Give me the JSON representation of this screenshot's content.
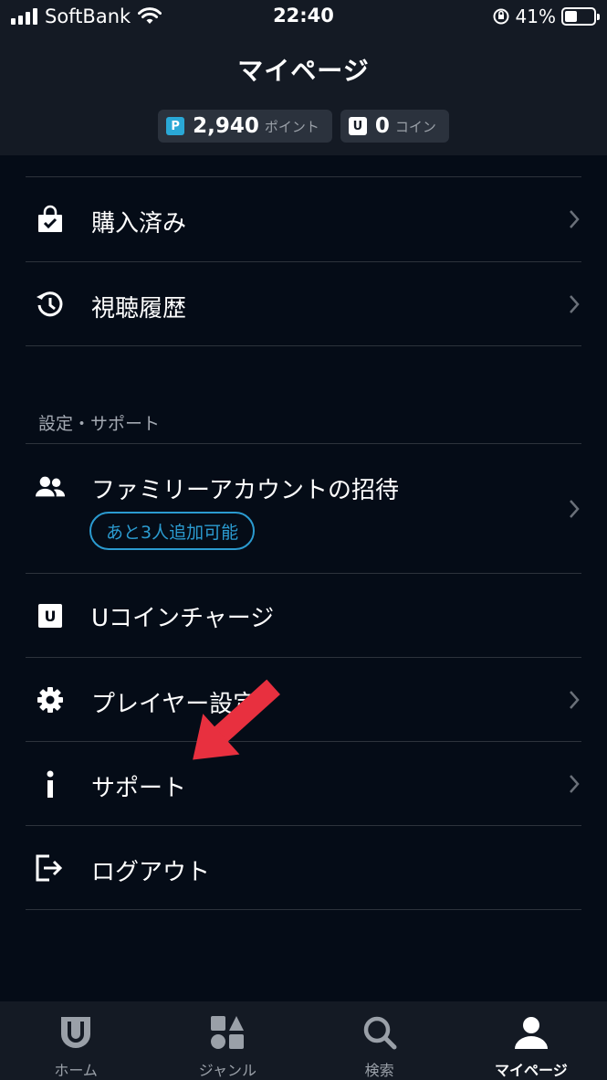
{
  "status_bar": {
    "carrier": "SoftBank",
    "time": "22:40",
    "battery": "41%"
  },
  "header": {
    "title": "マイページ",
    "points": {
      "badge": "P",
      "value": "2,940",
      "unit": "ポイント"
    },
    "coins": {
      "badge": "U",
      "value": "0",
      "unit": "コイン"
    }
  },
  "menu": {
    "purchased": "購入済み",
    "history": "視聴履歴",
    "section_settings": "設定・サポート",
    "family": "ファミリーアカウントの招待",
    "family_tag": "あと3人追加可能",
    "coin_charge_badge": "U",
    "coin_charge": "Uコインチャージ",
    "player_settings": "プレイヤー設定",
    "support": "サポート",
    "logout": "ログアウト"
  },
  "tabbar": {
    "home": "ホーム",
    "genre": "ジャンル",
    "search": "検索",
    "mypage": "マイページ",
    "active": "mypage"
  },
  "colors": {
    "background": "#050c17",
    "header": "#141a24",
    "accent": "#2b9bd0",
    "annotation_arrow": "#e8303f"
  }
}
